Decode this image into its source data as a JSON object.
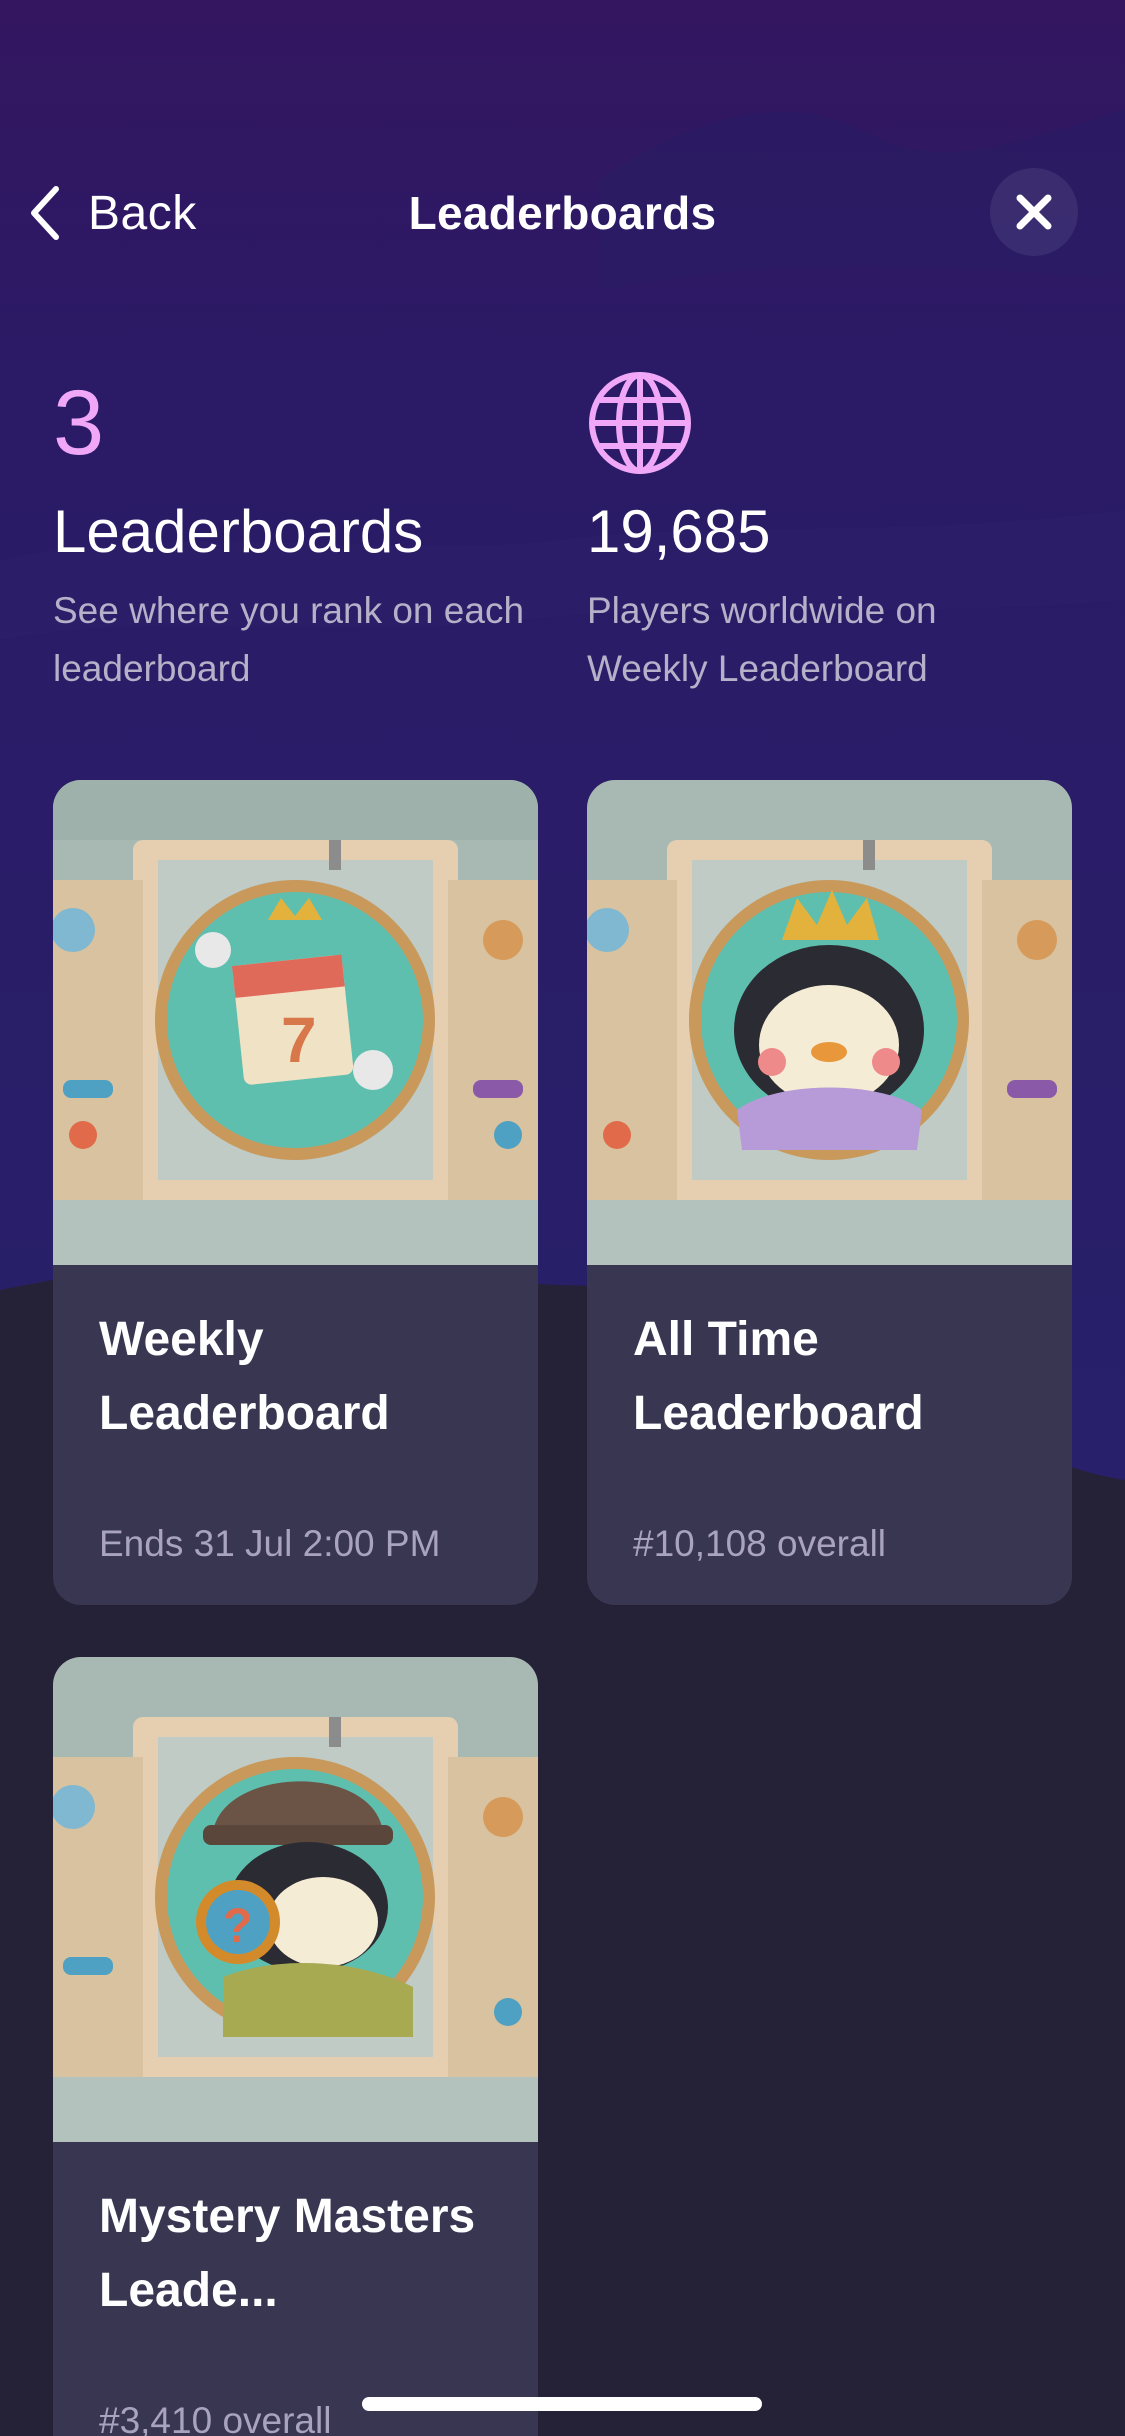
{
  "header": {
    "back_label": "Back",
    "title": "Leaderboards",
    "close_icon": "close-icon"
  },
  "stats": {
    "count": {
      "number": "3",
      "label": "Leaderboards",
      "description": "See where you rank on each leaderboard"
    },
    "players": {
      "icon": "globe-icon",
      "value": "19,685",
      "description": "Players worldwide on Weekly Leaderboard"
    }
  },
  "cards": [
    {
      "title": "Weekly Leaderboard",
      "subtitle": "Ends 31 Jul 2:00 PM",
      "image": "calendar-crown-embroidery"
    },
    {
      "title": "All Time Leaderboard",
      "subtitle": "#10,108 overall",
      "image": "penguin-king-embroidery"
    },
    {
      "title": "Mystery Masters Leade...",
      "subtitle": "#3,410 overall",
      "image": "penguin-detective-embroidery"
    }
  ],
  "colors": {
    "background_top": "#2f1a5e",
    "background_wave": "#2a1f6b",
    "background_bottom": "#252136",
    "accent_pink": "#f1a7f8",
    "card_bg": "#393652"
  }
}
